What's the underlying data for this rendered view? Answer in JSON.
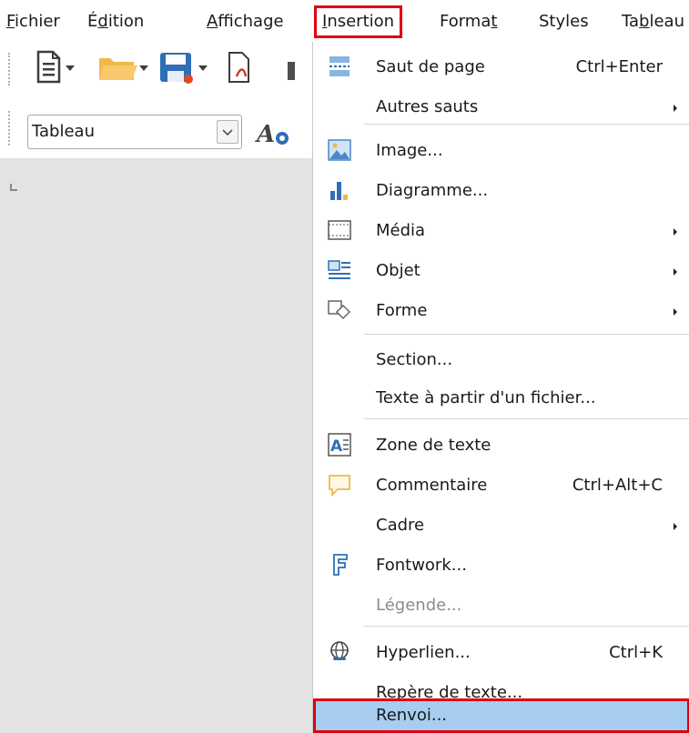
{
  "menubar": {
    "items": [
      {
        "label": "Fichier",
        "mnemonic_index": 0
      },
      {
        "label": "Édition",
        "mnemonic_index": 1
      },
      {
        "label": "Affichage",
        "mnemonic_index": 0
      },
      {
        "label": "Insertion",
        "mnemonic_index": 0
      },
      {
        "label": "Format",
        "mnemonic_index": 5
      },
      {
        "label": "Styles",
        "mnemonic_index": -1
      },
      {
        "label": "Tableau",
        "mnemonic_index": 2
      }
    ],
    "active_item": "Insertion"
  },
  "toolbar": {
    "paragraph_style": "Tableau",
    "icons": [
      "new-document-icon",
      "open-folder-icon",
      "save-icon",
      "export-pdf-icon",
      "fontwork-style-icon"
    ]
  },
  "insert_menu": {
    "items": [
      {
        "label": "Saut de page",
        "shortcut": "Ctrl+Enter",
        "icon": "page-break-icon"
      },
      {
        "label": "Autres sauts",
        "submenu": true
      },
      {
        "label": "Image...",
        "icon": "image-icon"
      },
      {
        "label": "Diagramme...",
        "icon": "chart-icon"
      },
      {
        "label": "Média",
        "submenu": true,
        "icon": "media-icon"
      },
      {
        "label": "Objet",
        "submenu": true,
        "icon": "object-icon"
      },
      {
        "label": "Forme",
        "submenu": true,
        "icon": "shape-icon"
      },
      {
        "label": "Section..."
      },
      {
        "label": "Texte à partir d'un fichier..."
      },
      {
        "label": "Zone de texte",
        "icon": "text-box-icon"
      },
      {
        "label": "Commentaire",
        "shortcut": "Ctrl+Alt+C",
        "icon": "comment-icon"
      },
      {
        "label": "Cadre",
        "submenu": true
      },
      {
        "label": "Fontwork...",
        "icon": "fontwork-icon"
      },
      {
        "label": "Légende...",
        "disabled": true
      },
      {
        "label": "Hyperlien...",
        "shortcut": "Ctrl+K",
        "icon": "hyperlink-icon"
      },
      {
        "label": "Repère de texte..."
      },
      {
        "label": "Renvoi...",
        "highlighted": true
      }
    ]
  },
  "colors": {
    "highlight": "#a7cdf0",
    "annotation_red": "#e0000f",
    "document_bg": "#e3e3e3",
    "disabled_text": "#8c8c8c"
  }
}
